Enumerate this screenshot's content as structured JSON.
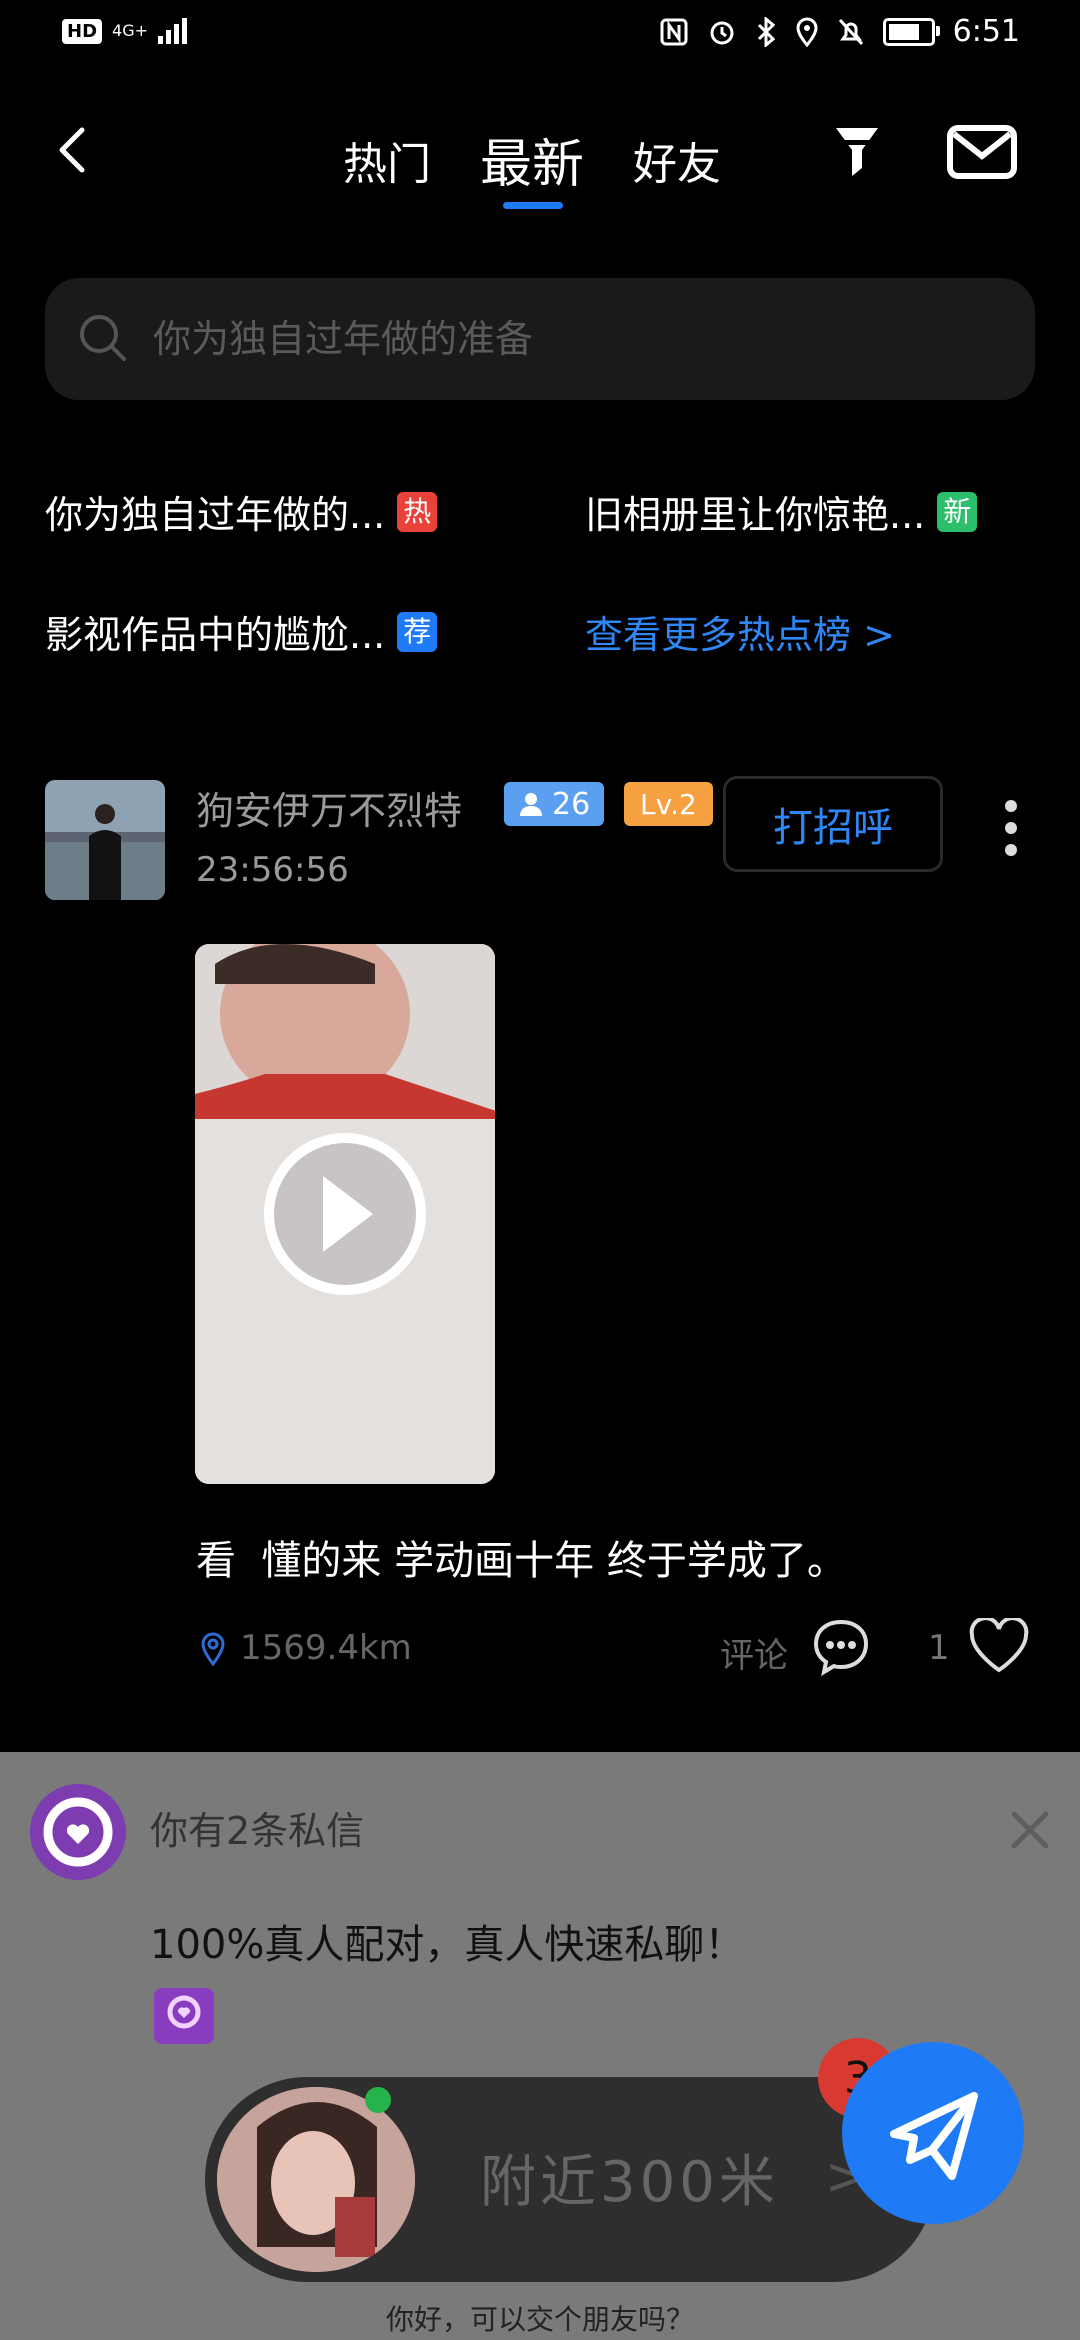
{
  "status_bar": {
    "hd": "HD",
    "network": "4G+",
    "time": "6:51"
  },
  "nav": {
    "tabs": [
      {
        "label": "热门"
      },
      {
        "label": "最新"
      },
      {
        "label": "好友"
      }
    ],
    "active_tab": "最新",
    "accent_color": "#1F7BF5"
  },
  "search": {
    "placeholder": "你为独自过年做的准备"
  },
  "hot_topics": [
    {
      "label": "你为独自过年做的...",
      "tag": "热",
      "tag_color": "#E8423A"
    },
    {
      "label": "旧相册里让你惊艳...",
      "tag": "新",
      "tag_color": "#2DBE6C"
    },
    {
      "label": "影视作品中的尴尬...",
      "tag": "荐",
      "tag_color": "#1F7BF5"
    }
  ],
  "more_hot_link": "查看更多热点榜 >",
  "post": {
    "username": "狗安伊万不烈特",
    "followers": "26",
    "level": "Lv.2",
    "time": "23:56:56",
    "greet_button": "打招呼",
    "caption": "看  懂的来 学动画十年 终于学成了。",
    "distance": "1569.4km",
    "comment_label": "评论",
    "likes": "1"
  },
  "notification": {
    "title": "你有2条私信",
    "message": "100%真人配对，真人快速私聊！",
    "nearby": "附近300米",
    "unread_count": "3",
    "hint": "你好，可以交个朋友吗？"
  }
}
